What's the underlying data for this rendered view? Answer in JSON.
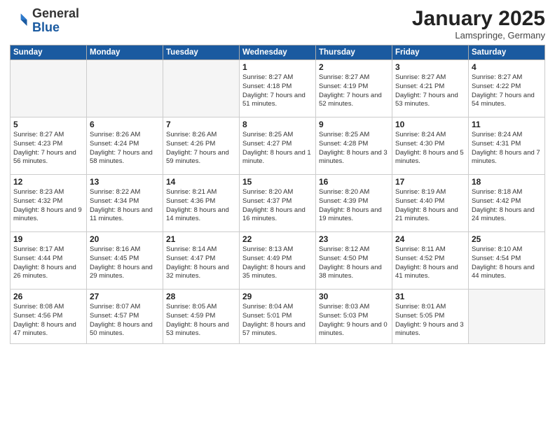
{
  "logo": {
    "general": "General",
    "blue": "Blue"
  },
  "header": {
    "month": "January 2025",
    "location": "Lamspringe, Germany"
  },
  "weekdays": [
    "Sunday",
    "Monday",
    "Tuesday",
    "Wednesday",
    "Thursday",
    "Friday",
    "Saturday"
  ],
  "weeks": [
    [
      {
        "day": "",
        "info": ""
      },
      {
        "day": "",
        "info": ""
      },
      {
        "day": "",
        "info": ""
      },
      {
        "day": "1",
        "info": "Sunrise: 8:27 AM\nSunset: 4:18 PM\nDaylight: 7 hours and 51 minutes."
      },
      {
        "day": "2",
        "info": "Sunrise: 8:27 AM\nSunset: 4:19 PM\nDaylight: 7 hours and 52 minutes."
      },
      {
        "day": "3",
        "info": "Sunrise: 8:27 AM\nSunset: 4:21 PM\nDaylight: 7 hours and 53 minutes."
      },
      {
        "day": "4",
        "info": "Sunrise: 8:27 AM\nSunset: 4:22 PM\nDaylight: 7 hours and 54 minutes."
      }
    ],
    [
      {
        "day": "5",
        "info": "Sunrise: 8:27 AM\nSunset: 4:23 PM\nDaylight: 7 hours and 56 minutes."
      },
      {
        "day": "6",
        "info": "Sunrise: 8:26 AM\nSunset: 4:24 PM\nDaylight: 7 hours and 58 minutes."
      },
      {
        "day": "7",
        "info": "Sunrise: 8:26 AM\nSunset: 4:26 PM\nDaylight: 7 hours and 59 minutes."
      },
      {
        "day": "8",
        "info": "Sunrise: 8:25 AM\nSunset: 4:27 PM\nDaylight: 8 hours and 1 minute."
      },
      {
        "day": "9",
        "info": "Sunrise: 8:25 AM\nSunset: 4:28 PM\nDaylight: 8 hours and 3 minutes."
      },
      {
        "day": "10",
        "info": "Sunrise: 8:24 AM\nSunset: 4:30 PM\nDaylight: 8 hours and 5 minutes."
      },
      {
        "day": "11",
        "info": "Sunrise: 8:24 AM\nSunset: 4:31 PM\nDaylight: 8 hours and 7 minutes."
      }
    ],
    [
      {
        "day": "12",
        "info": "Sunrise: 8:23 AM\nSunset: 4:32 PM\nDaylight: 8 hours and 9 minutes."
      },
      {
        "day": "13",
        "info": "Sunrise: 8:22 AM\nSunset: 4:34 PM\nDaylight: 8 hours and 11 minutes."
      },
      {
        "day": "14",
        "info": "Sunrise: 8:21 AM\nSunset: 4:36 PM\nDaylight: 8 hours and 14 minutes."
      },
      {
        "day": "15",
        "info": "Sunrise: 8:20 AM\nSunset: 4:37 PM\nDaylight: 8 hours and 16 minutes."
      },
      {
        "day": "16",
        "info": "Sunrise: 8:20 AM\nSunset: 4:39 PM\nDaylight: 8 hours and 19 minutes."
      },
      {
        "day": "17",
        "info": "Sunrise: 8:19 AM\nSunset: 4:40 PM\nDaylight: 8 hours and 21 minutes."
      },
      {
        "day": "18",
        "info": "Sunrise: 8:18 AM\nSunset: 4:42 PM\nDaylight: 8 hours and 24 minutes."
      }
    ],
    [
      {
        "day": "19",
        "info": "Sunrise: 8:17 AM\nSunset: 4:44 PM\nDaylight: 8 hours and 26 minutes."
      },
      {
        "day": "20",
        "info": "Sunrise: 8:16 AM\nSunset: 4:45 PM\nDaylight: 8 hours and 29 minutes."
      },
      {
        "day": "21",
        "info": "Sunrise: 8:14 AM\nSunset: 4:47 PM\nDaylight: 8 hours and 32 minutes."
      },
      {
        "day": "22",
        "info": "Sunrise: 8:13 AM\nSunset: 4:49 PM\nDaylight: 8 hours and 35 minutes."
      },
      {
        "day": "23",
        "info": "Sunrise: 8:12 AM\nSunset: 4:50 PM\nDaylight: 8 hours and 38 minutes."
      },
      {
        "day": "24",
        "info": "Sunrise: 8:11 AM\nSunset: 4:52 PM\nDaylight: 8 hours and 41 minutes."
      },
      {
        "day": "25",
        "info": "Sunrise: 8:10 AM\nSunset: 4:54 PM\nDaylight: 8 hours and 44 minutes."
      }
    ],
    [
      {
        "day": "26",
        "info": "Sunrise: 8:08 AM\nSunset: 4:56 PM\nDaylight: 8 hours and 47 minutes."
      },
      {
        "day": "27",
        "info": "Sunrise: 8:07 AM\nSunset: 4:57 PM\nDaylight: 8 hours and 50 minutes."
      },
      {
        "day": "28",
        "info": "Sunrise: 8:05 AM\nSunset: 4:59 PM\nDaylight: 8 hours and 53 minutes."
      },
      {
        "day": "29",
        "info": "Sunrise: 8:04 AM\nSunset: 5:01 PM\nDaylight: 8 hours and 57 minutes."
      },
      {
        "day": "30",
        "info": "Sunrise: 8:03 AM\nSunset: 5:03 PM\nDaylight: 9 hours and 0 minutes."
      },
      {
        "day": "31",
        "info": "Sunrise: 8:01 AM\nSunset: 5:05 PM\nDaylight: 9 hours and 3 minutes."
      },
      {
        "day": "",
        "info": ""
      }
    ]
  ]
}
